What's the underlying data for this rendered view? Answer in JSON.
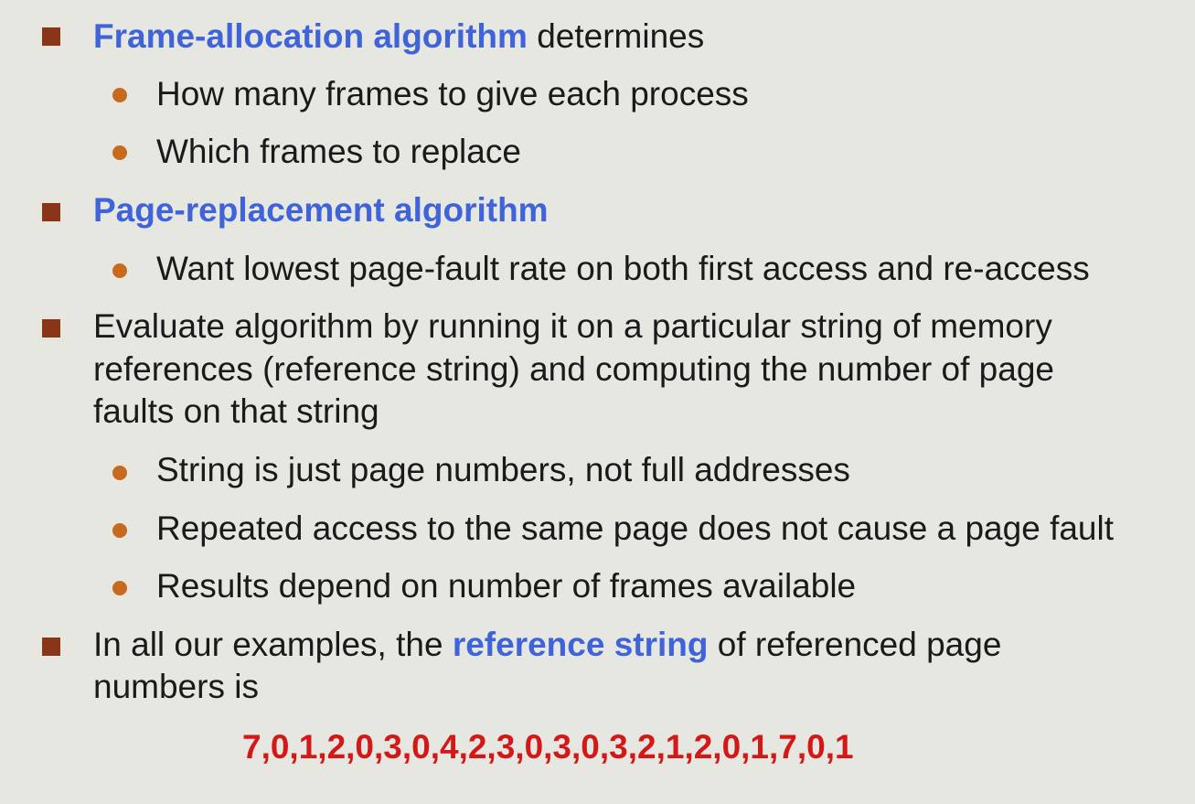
{
  "bullets": {
    "b1": {
      "highlight": "Frame-allocation algorithm",
      "text": " determines",
      "sub": [
        "How many frames to give each process",
        "Which frames to replace"
      ]
    },
    "b2": {
      "highlight": "Page-replacement algorithm",
      "sub": [
        "Want lowest page-fault rate on both first access and re-access"
      ]
    },
    "b3": {
      "lines": [
        "Evaluate algorithm by running it on a particular string of memory",
        "references (reference string) and computing the number of page",
        "faults on that string"
      ],
      "sub": [
        "String is just page numbers, not full addresses",
        "Repeated access to the same page does not cause a page fault",
        "Results depend on number of frames available"
      ]
    },
    "b4": {
      "pre": "In all our examples, the ",
      "highlight": "reference string",
      "post": " of referenced page",
      "line2": "numbers is"
    }
  },
  "reference_string": "7,0,1,2,0,3,0,4,2,3,0,3,0,3,2,1,2,0,1,7,0,1",
  "colors": {
    "background": "#e6e7e1",
    "square_bullet": "#8a3418",
    "round_bullet": "#c86a1e",
    "highlight_blue": "#3f63d8",
    "reference_red": "#d41818"
  }
}
